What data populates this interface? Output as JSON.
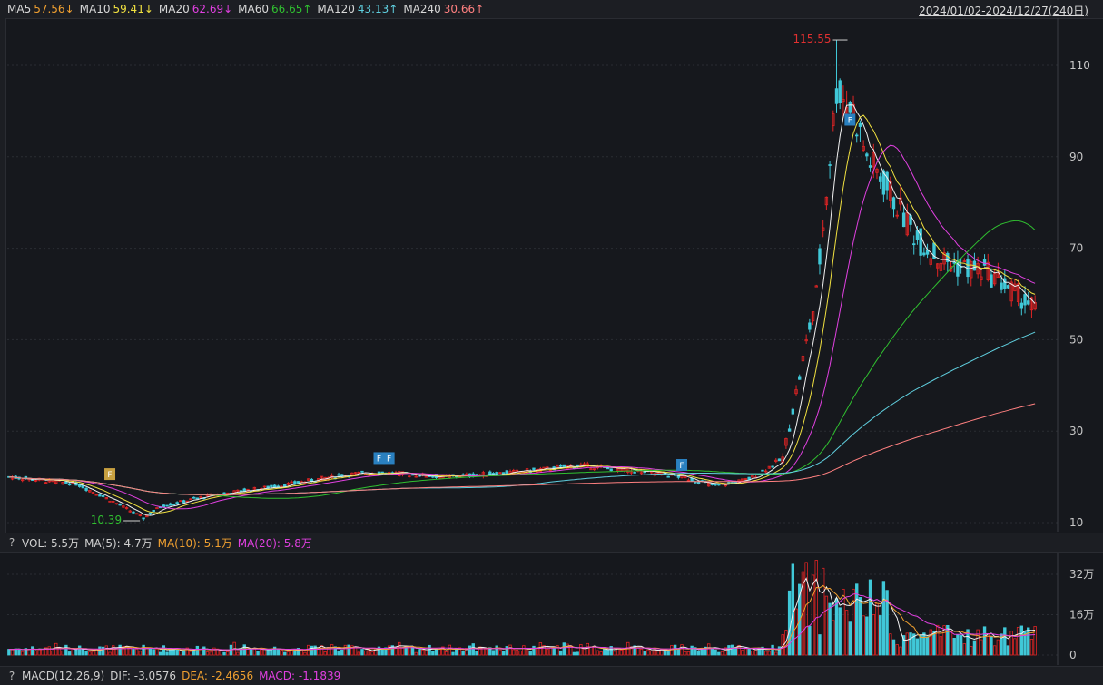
{
  "header": {
    "ma_items": [
      {
        "label": "MA5",
        "value": "57.56",
        "arrow": "↓",
        "color": "#f0a030"
      },
      {
        "label": "MA10",
        "value": "59.41",
        "arrow": "↓",
        "color": "#f0e040"
      },
      {
        "label": "MA20",
        "value": "62.69",
        "arrow": "↓",
        "color": "#e040e0"
      },
      {
        "label": "MA60",
        "value": "66.65",
        "arrow": "↑",
        "color": "#30c030"
      },
      {
        "label": "MA120",
        "value": "43.13",
        "arrow": "↑",
        "color": "#60d0e0"
      },
      {
        "label": "MA240",
        "value": "30.66",
        "arrow": "↑",
        "color": "#ff8080"
      }
    ],
    "date_range": "2024/01/02-2024/12/27(240日)"
  },
  "volume_header": {
    "q": "?",
    "vol": "VOL: 5.5万",
    "ma5": "MA(5): 4.7万",
    "ma10": "MA(10): 5.1万",
    "ma20": "MA(20): 5.8万",
    "colors": {
      "vol": "#d8d8d8",
      "ma5": "#d8d8d8",
      "ma10": "#f0a030",
      "ma20": "#e040e0"
    }
  },
  "macd_header": {
    "q": "?",
    "title": "MACD(12,26,9)",
    "dif": "DIF: -3.0576",
    "dea": "DEA: -2.4656",
    "macd": "MACD: -1.1839",
    "colors": {
      "dif": "#d8d8d8",
      "dea": "#f0a030",
      "macd": "#e040e0"
    }
  },
  "chart_data": [
    {
      "type": "candlestick",
      "price_axis": {
        "ticks": [
          "110",
          "90",
          "70",
          "50",
          "30",
          "10"
        ],
        "range": [
          10,
          115
        ]
      },
      "annotations": {
        "high": "115.55",
        "low": "10.39"
      },
      "markers": [
        "F",
        "F",
        "F",
        "F",
        "F"
      ],
      "series_colors": {
        "up": "#e02424",
        "down": "#40c8d8",
        "ma5": "#f0f0f0",
        "ma10": "#f0e040",
        "ma20": "#e040e0",
        "ma60": "#30c030",
        "ma120": "#60d0e0",
        "ma240": "#ff8080"
      },
      "keypoints": [
        [
          0,
          20
        ],
        [
          20,
          18.5
        ],
        [
          30,
          15
        ],
        [
          40,
          11
        ],
        [
          45,
          13.5
        ],
        [
          60,
          16
        ],
        [
          80,
          18
        ],
        [
          100,
          20.5
        ],
        [
          110,
          21
        ],
        [
          130,
          20
        ],
        [
          150,
          21
        ],
        [
          170,
          22.5
        ],
        [
          190,
          21
        ],
        [
          200,
          20
        ],
        [
          210,
          18
        ],
        [
          220,
          19.5
        ],
        [
          230,
          24
        ],
        [
          240,
          60
        ],
        [
          246,
          105
        ],
        [
          251,
          100
        ],
        [
          255,
          90
        ],
        [
          262,
          82
        ],
        [
          270,
          72
        ],
        [
          276,
          68
        ],
        [
          282,
          66
        ],
        [
          290,
          65
        ],
        [
          296,
          62
        ],
        [
          303,
          58
        ],
        [
          305,
          57
        ]
      ]
    },
    {
      "type": "bar",
      "axis_ticks": [
        "32万",
        "16万",
        "0"
      ],
      "range": [
        0,
        38
      ]
    }
  ]
}
